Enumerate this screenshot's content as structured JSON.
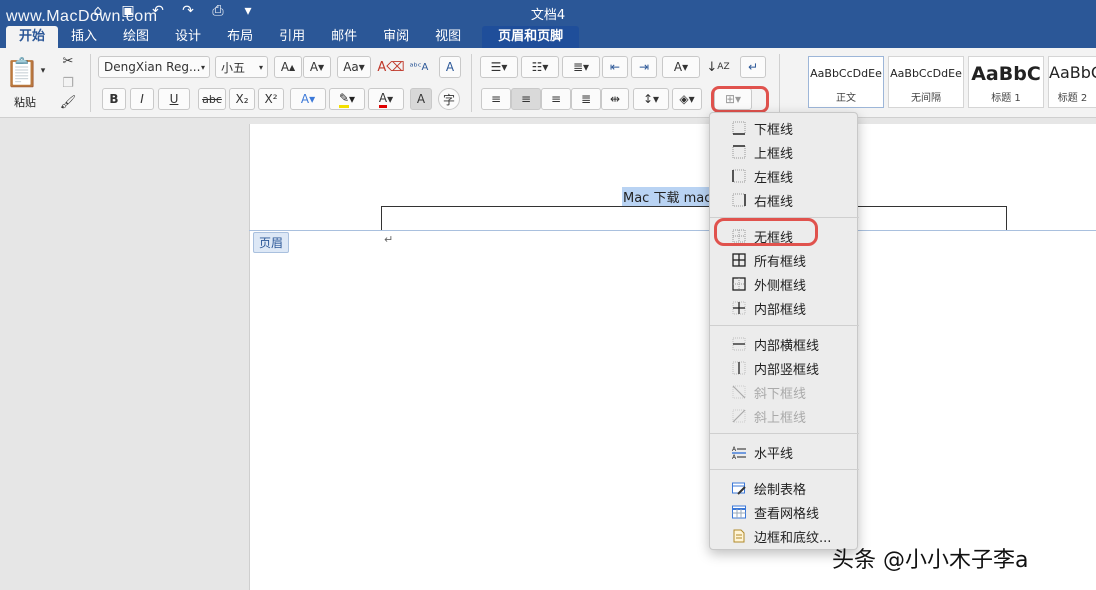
{
  "window": {
    "watermark": "www.MacDown.com",
    "title": "文档4"
  },
  "tabs": [
    "开始",
    "插入",
    "绘图",
    "设计",
    "布局",
    "引用",
    "邮件",
    "审阅",
    "视图"
  ],
  "context_tab": "页眉和页脚",
  "ribbon": {
    "paste_label": "粘贴",
    "font_name": "DengXian Reg...",
    "font_size": "小五",
    "bold": "B",
    "italic": "I",
    "underline": "U",
    "strike": "abc",
    "subscript": "X₂",
    "superscript": "X²",
    "styles": [
      {
        "sample": "AaBbCcDdEe",
        "name": "正文"
      },
      {
        "sample": "AaBbCcDdEe",
        "name": "无间隔"
      },
      {
        "sample": "AaBbC",
        "name": "标题 1"
      },
      {
        "sample": "AaBbC",
        "name": "标题 2"
      }
    ]
  },
  "document": {
    "header_text": "Mac 下载 macd",
    "header_tag": "页眉",
    "para_mark": "↵"
  },
  "border_menu": {
    "items": [
      {
        "label": "下框线",
        "icon": "bottom-border-icon",
        "enabled": true
      },
      {
        "label": "上框线",
        "icon": "top-border-icon",
        "enabled": true
      },
      {
        "label": "左框线",
        "icon": "left-border-icon",
        "enabled": true
      },
      {
        "label": "右框线",
        "icon": "right-border-icon",
        "enabled": true
      },
      {
        "label": "无框线",
        "icon": "no-border-icon",
        "enabled": true
      },
      {
        "label": "所有框线",
        "icon": "all-borders-icon",
        "enabled": true
      },
      {
        "label": "外侧框线",
        "icon": "outside-borders-icon",
        "enabled": true
      },
      {
        "label": "内部框线",
        "icon": "inside-borders-icon",
        "enabled": true
      },
      {
        "label": "内部横框线",
        "icon": "inside-horizontal-border-icon",
        "enabled": true
      },
      {
        "label": "内部竖框线",
        "icon": "inside-vertical-border-icon",
        "enabled": true
      },
      {
        "label": "斜下框线",
        "icon": "diagonal-down-border-icon",
        "enabled": false
      },
      {
        "label": "斜上框线",
        "icon": "diagonal-up-border-icon",
        "enabled": false
      },
      {
        "label": "水平线",
        "icon": "horizontal-line-icon",
        "enabled": true
      },
      {
        "label": "绘制表格",
        "icon": "draw-table-icon",
        "enabled": true
      },
      {
        "label": "查看网格线",
        "icon": "view-gridlines-icon",
        "enabled": true
      },
      {
        "label": "边框和底纹...",
        "icon": "borders-shading-icon",
        "enabled": true
      }
    ]
  },
  "bottom_watermark": "头条 @小小木子李a"
}
